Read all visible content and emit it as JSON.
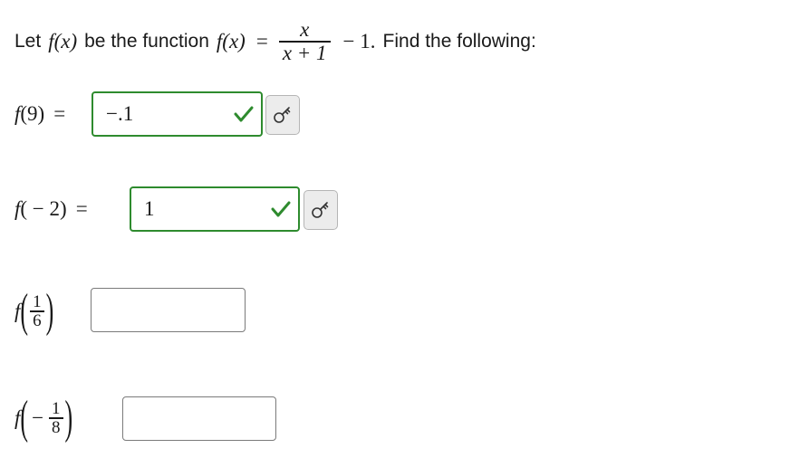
{
  "prompt": {
    "lead": "Let",
    "fx": "f(x)",
    "middle": "be the function",
    "fx2": "f(x)",
    "eq": "=",
    "frac_num": "x",
    "frac_den": "x + 1",
    "minus_one": "− 1.",
    "tail": "Find the following:"
  },
  "questions": [
    {
      "label_fn": "f",
      "label_arg": "(9)",
      "eq": "=",
      "value": "−.1",
      "status": "correct"
    },
    {
      "label_fn": "f",
      "label_arg": "( − 2)",
      "eq": "=",
      "value": "1",
      "status": "correct"
    },
    {
      "label_fn": "f",
      "arg_sign": "",
      "arg_num": "1",
      "arg_den": "6",
      "value": "",
      "status": "empty"
    },
    {
      "label_fn": "f",
      "arg_sign": "−",
      "arg_num": "1",
      "arg_den": "8",
      "value": "",
      "status": "empty"
    }
  ],
  "icons": {
    "check": "check-icon",
    "key": "key-icon"
  },
  "colors": {
    "correct_border": "#2e8b2e",
    "check": "#2e8b2e",
    "input_border": "#7a7a7a",
    "key_bg": "#ececec"
  }
}
